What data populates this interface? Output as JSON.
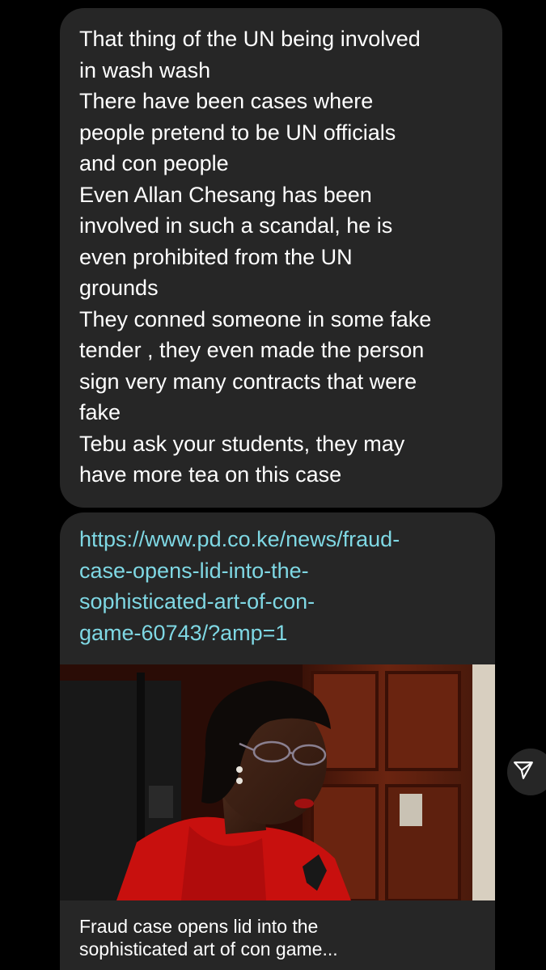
{
  "message": {
    "lines": [
      "That thing of the UN being involved",
      "in wash wash",
      "There have been cases where",
      "people pretend to be UN officials",
      "and con people",
      "Even Allan Chesang has been",
      "involved in such a scandal, he is",
      "even prohibited from the UN",
      "grounds",
      "They conned someone in some fake",
      "tender , they even made the person",
      "sign very many contracts that were",
      "fake",
      "Tebu ask your students,  they may",
      "have more tea on this case"
    ]
  },
  "link_message": {
    "url_lines": [
      "https://www.pd.co.ke/news/fraud-",
      "case-opens-lid-into-the-",
      "sophisticated-art-of-con-",
      "game-60743/?amp=1"
    ],
    "preview_title_lines": [
      "Fraud case opens lid into the",
      "sophisticated art of con game..."
    ],
    "link_color": "#7fd8e4"
  },
  "colors": {
    "background": "#000000",
    "bubble": "#262626",
    "text": "#ffffff"
  },
  "icons": {
    "share": "paper-plane-icon"
  }
}
